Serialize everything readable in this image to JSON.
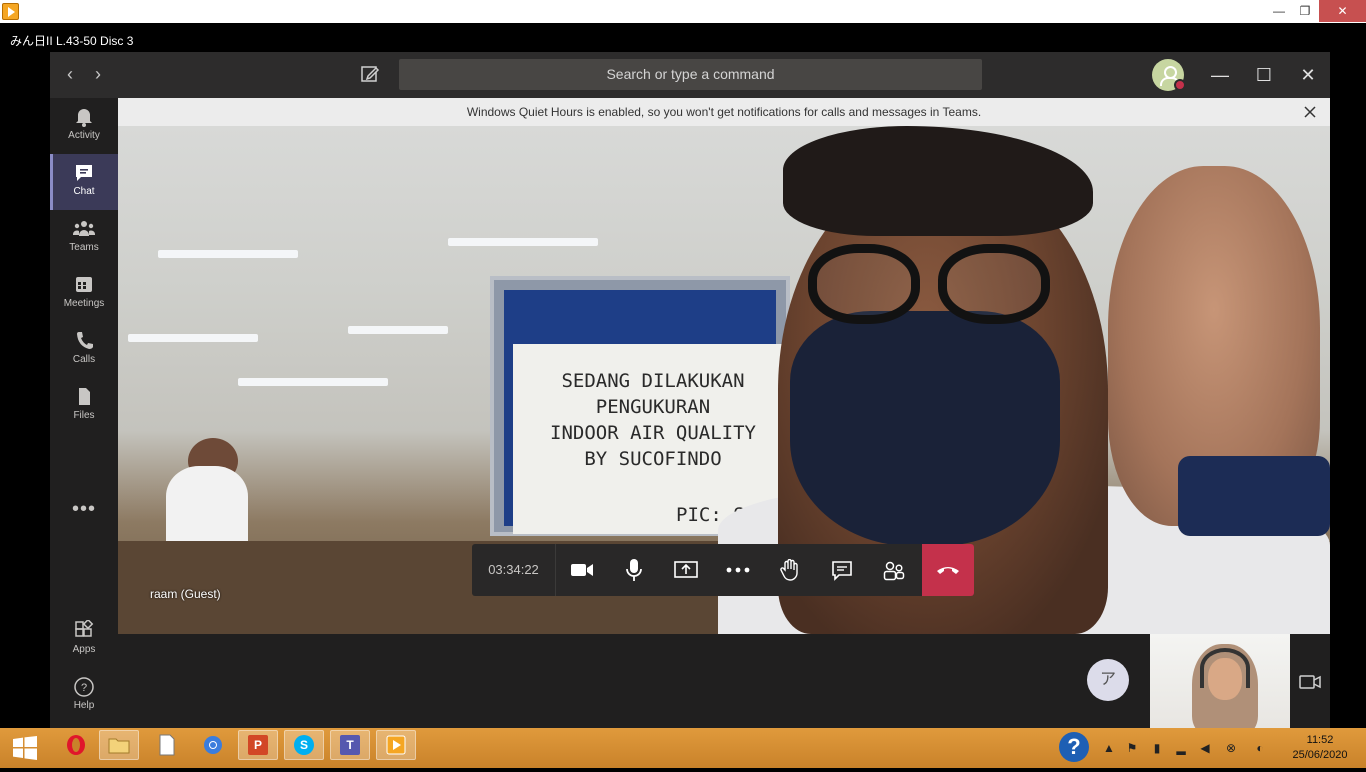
{
  "window": {
    "media_title": "みん日II L.43-50 Disc 3"
  },
  "teams": {
    "search_placeholder": "Search or type a command",
    "quiet_hours_banner": "Windows Quiet Hours is enabled, so you won't get notifications for calls and messages in Teams.",
    "rail": [
      {
        "label": "Activity",
        "icon": "bell-icon"
      },
      {
        "label": "Chat",
        "icon": "chat-icon",
        "active": true
      },
      {
        "label": "Teams",
        "icon": "teams-icon"
      },
      {
        "label": "Meetings",
        "icon": "calendar-icon"
      },
      {
        "label": "Calls",
        "icon": "phone-icon"
      },
      {
        "label": "Files",
        "icon": "file-icon"
      }
    ],
    "rail_more": "•••",
    "rail_bottom": [
      {
        "label": "Apps",
        "icon": "apps-icon"
      },
      {
        "label": "Help",
        "icon": "help-icon"
      }
    ]
  },
  "call": {
    "timer": "03:34:22",
    "guest_label": "raam (Guest)",
    "sign_lines": [
      "SEDANG DILAKUKAN",
      "PENGUKURAN",
      "INDOOR AIR QUALITY",
      "BY SUCOFINDO"
    ],
    "sign_pic": "PIC: SHE",
    "ime_badge": "ア",
    "hangup_color": "#c4314b"
  },
  "taskbar": {
    "time": "11:52",
    "date": "25/06/2020",
    "accent": "#d38d33"
  }
}
